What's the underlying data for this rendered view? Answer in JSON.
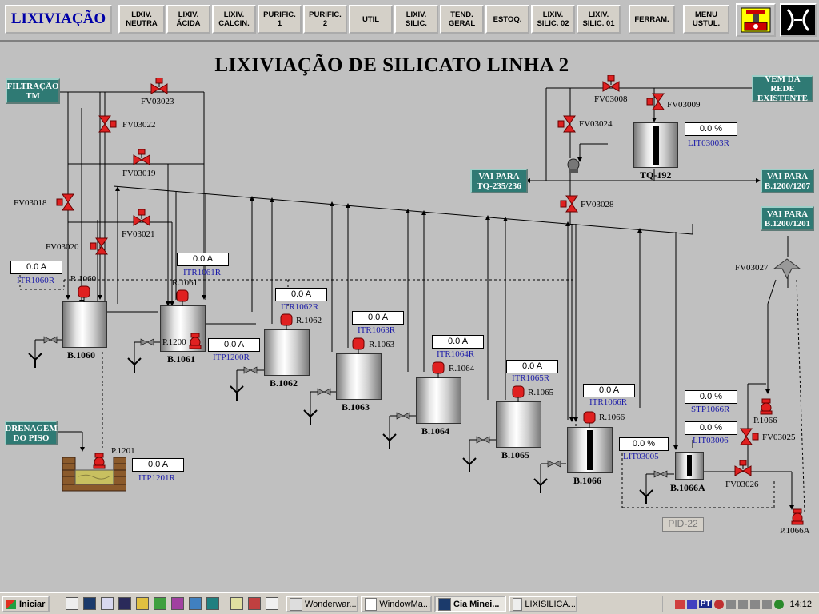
{
  "app_title": "LIXIVIAÇÃO",
  "nav_buttons": [
    "LIXIV.\nNEUTRA",
    "LIXIV.\nÁCIDA",
    "LIXIV.\nCALCIN.",
    "PURIFIC.\n1",
    "PURIFIC.\n2",
    "UTIL",
    "LIXIV.\nSILIC.",
    "TEND.\nGERAL",
    "ESTOQ.",
    "LIXIV.\nSILIC. 02",
    "LIXIV.\nSILIC. 01",
    "FERRAM.",
    "MENU\nUSTUL."
  ],
  "screen_title": "LIXIVIAÇÃO DE SILICATO LINHA 2",
  "destinations": {
    "filtracao": "FILTRAÇÃO\nTM",
    "vem_rede": "VEM DA REDE\nEXISTENTE",
    "vai_tq235": "VAI PARA\nTQ-235/236",
    "vai_b1200_1207": "VAI PARA\nB.1200/1207",
    "vai_b1200_1201": "VAI PARA\nB.1200/1201",
    "drenagem": "DRENAGEM\nDO PISO"
  },
  "valves": {
    "fv03023": "FV03023",
    "fv03022": "FV03022",
    "fv03019": "FV03019",
    "fv03018": "FV03018",
    "fv03020": "FV03020",
    "fv03021": "FV03021",
    "fv03008": "FV03008",
    "fv03009": "FV03009",
    "fv03024": "FV03024",
    "fv03028": "FV03028",
    "fv03027": "FV03027",
    "fv03025": "FV03025",
    "fv03026": "FV03026"
  },
  "readouts": {
    "itr1060r": {
      "value": "0.0 A",
      "tag": "ITR1060R"
    },
    "itr1061r": {
      "value": "0.0 A",
      "tag": "ITR1061R"
    },
    "itr1062r": {
      "value": "0.0 A",
      "tag": "ITR1062R"
    },
    "itr1063r": {
      "value": "0.0 A",
      "tag": "ITR1063R"
    },
    "itr1064r": {
      "value": "0.0 A",
      "tag": "ITR1064R"
    },
    "itr1065r": {
      "value": "0.0 A",
      "tag": "ITR1065R"
    },
    "itr1066r": {
      "value": "0.0 A",
      "tag": "ITR1066R"
    },
    "itp1200r": {
      "value": "0.0 A",
      "tag": "ITP1200R"
    },
    "itp1201r": {
      "value": "0.0 A",
      "tag": "ITP1201R"
    },
    "lit03003r": {
      "value": "0.0 %",
      "tag": "LIT03003R"
    },
    "lit03005": {
      "value": "0.0 %",
      "tag": "LIT03005"
    },
    "stp1066r": {
      "value": "0.0 %",
      "tag": "STP1066R"
    },
    "lit03006": {
      "value": "0.0 %",
      "tag": "LIT03006"
    }
  },
  "agitators": {
    "r1060": "R.1060",
    "r1061": "R.1061",
    "r1062": "R.1062",
    "r1063": "R.1063",
    "r1064": "R.1064",
    "r1065": "R.1065",
    "r1066": "R.1066"
  },
  "pumps": {
    "p1200": "P.1200",
    "p1201": "P.1201",
    "p1066": "P.1066",
    "p1066a": "P.1066A"
  },
  "tanks": {
    "b1060": "B.1060",
    "b1061": "B.1061",
    "b1062": "B.1062",
    "b1063": "B.1063",
    "b1064": "B.1064",
    "b1065": "B.1065",
    "b1066": "B.1066",
    "b1066a": "B.1066A",
    "tq192": "TQ-192"
  },
  "pid_label": "PID-22",
  "taskbar": {
    "start": "Iniciar",
    "items": [
      "Wonderwar...",
      "WindowMa...",
      "Cia Minei...",
      "LIXISILICA..."
    ],
    "clock": "14:12",
    "lang": "PT"
  },
  "colors": {
    "valve": "#e02020",
    "teal": "#2f7a74",
    "tag_blue": "#1a1aa8"
  }
}
